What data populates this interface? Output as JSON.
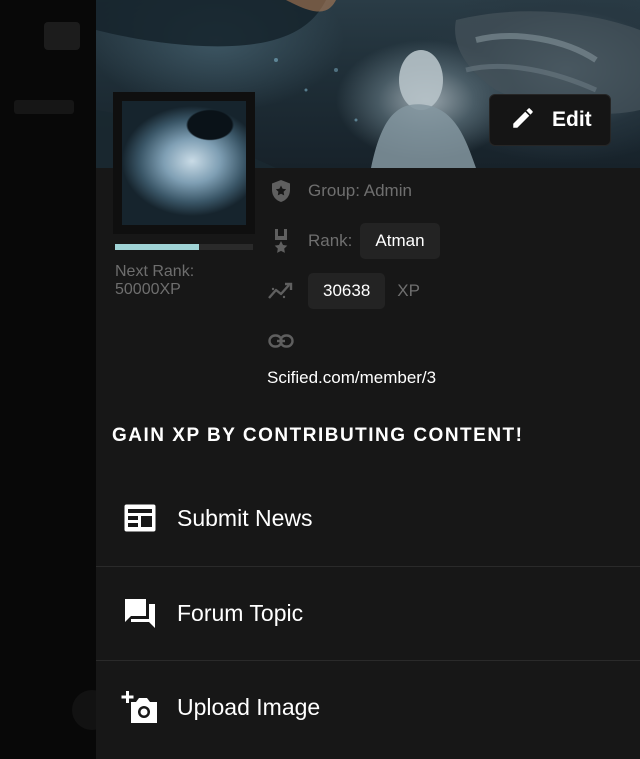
{
  "profile": {
    "edit_label": "Edit",
    "rank_progress": 0.61,
    "next_rank_label": "Next Rank:",
    "next_rank_value": "50000XP",
    "group_text": "Group: Admin",
    "rank_label": "Rank:",
    "rank_value": "Atman",
    "xp_value": "30638",
    "xp_unit": "XP",
    "profile_url": "Scified.com/member/3"
  },
  "contribute": {
    "heading": "GAIN XP BY CONTRIBUTING CONTENT!",
    "actions": [
      {
        "label": "Submit News",
        "icon": "newspaper-icon"
      },
      {
        "label": "Forum Topic",
        "icon": "forum-icon"
      },
      {
        "label": "Upload Image",
        "icon": "add-photo-icon"
      }
    ]
  },
  "colors": {
    "drawer_bg": "#171717",
    "progress_fill": "#9fd3d5",
    "muted_text": "#6f6f6f",
    "chip_bg": "#232323"
  }
}
